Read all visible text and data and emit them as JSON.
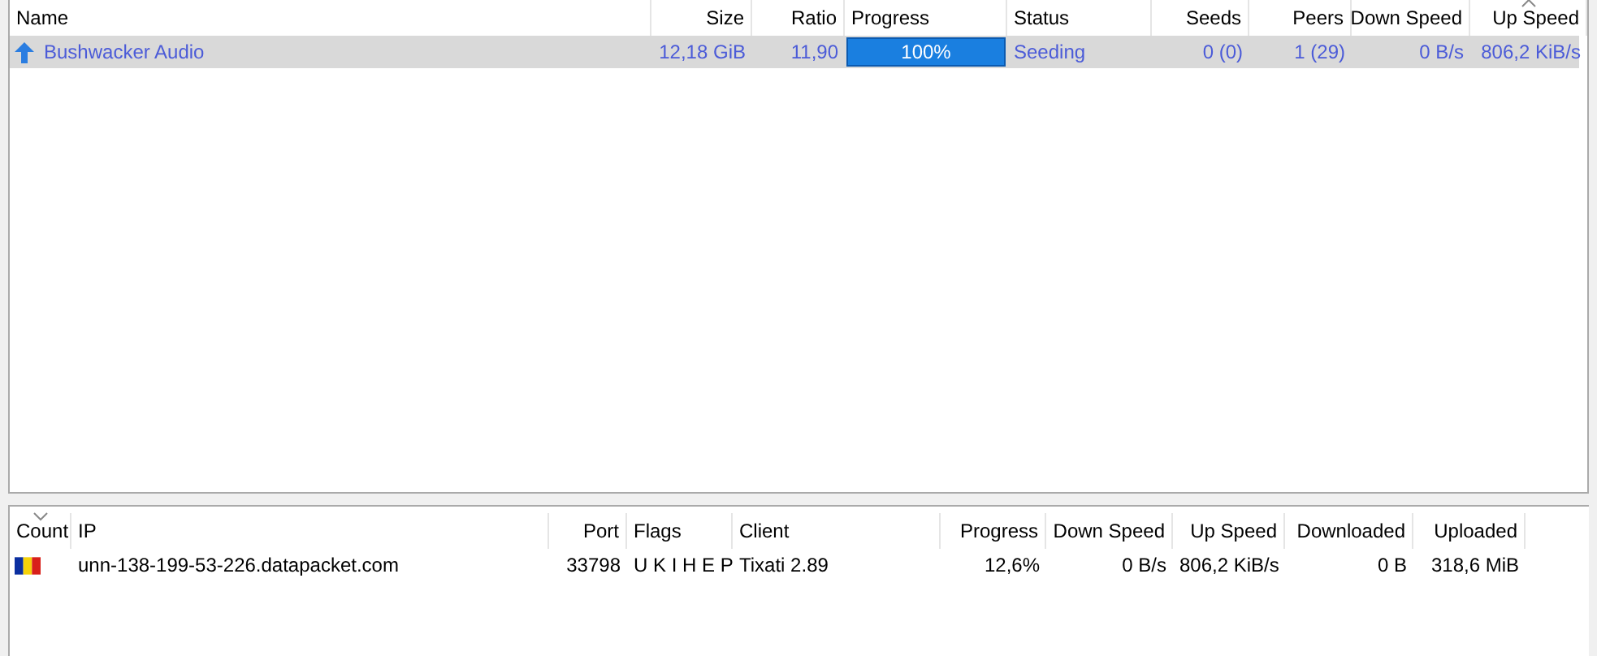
{
  "torrents": {
    "columns": [
      {
        "label": "Name",
        "right_aligned": false,
        "sorted": false
      },
      {
        "label": "Size",
        "right_aligned": true,
        "sorted": false
      },
      {
        "label": "Ratio",
        "right_aligned": true,
        "sorted": false
      },
      {
        "label": "Progress",
        "right_aligned": false,
        "sorted": false
      },
      {
        "label": "Status",
        "right_aligned": false,
        "sorted": false
      },
      {
        "label": "Seeds",
        "right_aligned": true,
        "sorted": false
      },
      {
        "label": "Peers",
        "right_aligned": true,
        "sorted": false
      },
      {
        "label": "Down Speed",
        "right_aligned": true,
        "sorted": false
      },
      {
        "label": "Up Speed",
        "right_aligned": true,
        "sorted": true,
        "descending": false
      }
    ],
    "rows": [
      {
        "selected": true,
        "name": "Bushwacker Audio",
        "size": "12,18 GiB",
        "ratio": "11,90",
        "progress": {
          "level": 1,
          "text": "100%"
        },
        "status": "Seeding",
        "seeds": "0 (0)",
        "peers": "1 (29)",
        "down_speed": "0 B/s",
        "up_speed": "806,2 KiB/s"
      }
    ]
  },
  "peers": {
    "columns": [
      {
        "label": "Count",
        "right_aligned": false,
        "sorted": true,
        "descending": true
      },
      {
        "label": "IP",
        "right_aligned": false,
        "sorted": false
      },
      {
        "label": "Port",
        "right_aligned": true,
        "sorted": false
      },
      {
        "label": "Flags",
        "right_aligned": false,
        "sorted": false
      },
      {
        "label": "Client",
        "right_aligned": false,
        "sorted": false
      },
      {
        "label": "Progress",
        "right_aligned": true,
        "sorted": false
      },
      {
        "label": "Down Speed",
        "right_aligned": true,
        "sorted": false
      },
      {
        "label": "Up Speed",
        "right_aligned": true,
        "sorted": false
      },
      {
        "label": "Downloaded",
        "right_aligned": true,
        "sorted": false
      },
      {
        "label": "Uploaded",
        "right_aligned": true,
        "sorted": false
      }
    ],
    "rows": [
      {
        "ip": "unn-138-199-53-226.datapacket.com",
        "port": "33798",
        "flags": "U K I H E P",
        "client": "Tixati 2.89",
        "progress": "12,6%",
        "down_speed": "0 B/s",
        "up_speed": "806,2 KiB/s",
        "downloaded": "0 B",
        "uploaded": "318,6 MiB"
      }
    ]
  }
}
